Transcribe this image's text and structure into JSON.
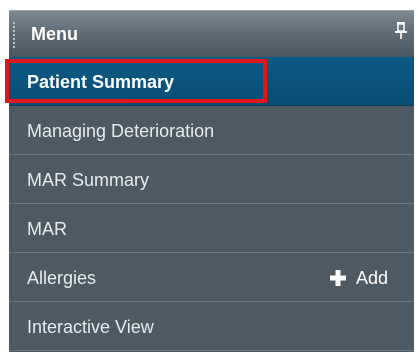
{
  "menu": {
    "title": "Menu",
    "header_icon": "pin-icon",
    "items": [
      {
        "label": "Patient Summary",
        "selected": true
      },
      {
        "label": "Managing Deterioration"
      },
      {
        "label": "MAR Summary"
      },
      {
        "label": "MAR"
      },
      {
        "label": "Allergies",
        "action": {
          "icon": "plus-icon",
          "label": "Add"
        }
      },
      {
        "label": "Interactive View"
      }
    ]
  },
  "colors": {
    "header": "#616d77",
    "list_background": "#4d5a63",
    "selected_background": "#0c5a86",
    "highlight_outline": "#e3161b",
    "text": "#e6ecef"
  }
}
